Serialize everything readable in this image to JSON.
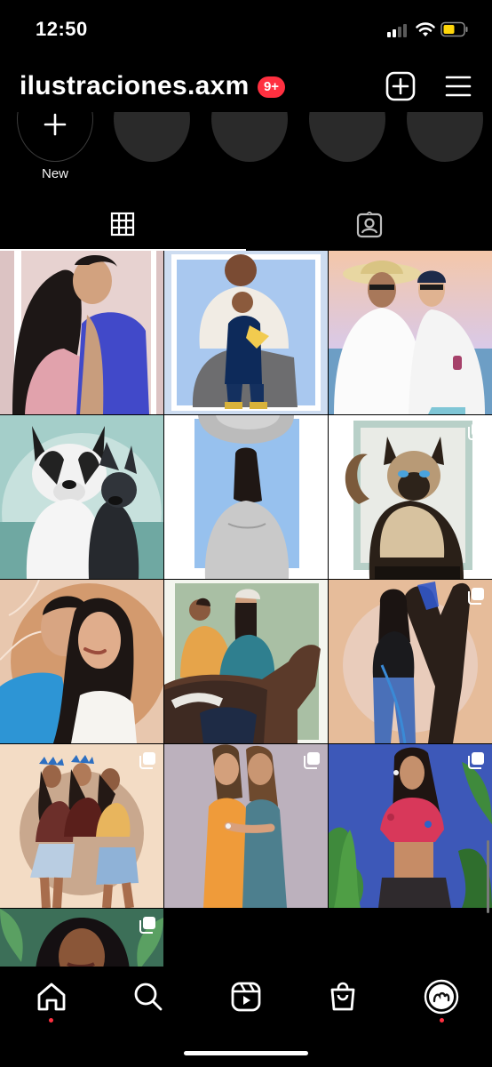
{
  "status_bar": {
    "time": "12:50",
    "battery_color": "#ffd60a"
  },
  "header": {
    "username": "ilustraciones.axm",
    "notifications_badge": "9+",
    "badge_color": "#ff3040"
  },
  "highlights": {
    "new_label": "New"
  },
  "tabs": [
    {
      "name": "posts-grid",
      "active": true
    },
    {
      "name": "tagged",
      "active": false
    }
  ],
  "grid": {
    "posts": [
      {
        "subject": "couple-kissing",
        "multi": false
      },
      {
        "subject": "father-and-child",
        "multi": false
      },
      {
        "subject": "two-men-in-white",
        "multi": false
      },
      {
        "subject": "french-bulldogs",
        "multi": false
      },
      {
        "subject": "woman-in-hoodie",
        "multi": true
      },
      {
        "subject": "siamese-cat",
        "multi": true
      },
      {
        "subject": "couple-selfie",
        "multi": false
      },
      {
        "subject": "couple-on-horse",
        "multi": false
      },
      {
        "subject": "woman-with-horse",
        "multi": true
      },
      {
        "subject": "three-friends",
        "multi": true
      },
      {
        "subject": "two-women-hugging",
        "multi": true
      },
      {
        "subject": "woman-tropical-leaves",
        "multi": true
      },
      {
        "subject": "woman-portrait-leaves",
        "multi": true
      }
    ]
  },
  "bottom_nav": {
    "items": [
      "home",
      "search",
      "reels",
      "shop",
      "profile"
    ],
    "active": "home"
  }
}
